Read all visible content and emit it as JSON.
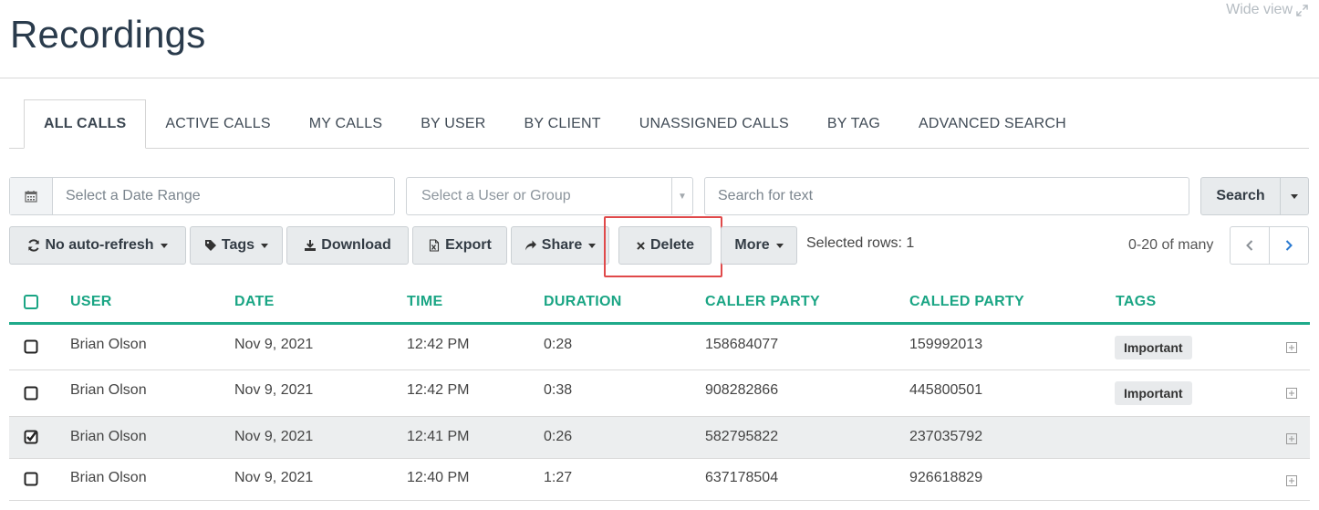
{
  "header": {
    "title": "Recordings",
    "wide_view": "Wide view"
  },
  "tabs": [
    {
      "label": "ALL CALLS",
      "active": true
    },
    {
      "label": "ACTIVE CALLS"
    },
    {
      "label": "MY CALLS"
    },
    {
      "label": "BY USER"
    },
    {
      "label": "BY CLIENT"
    },
    {
      "label": "UNASSIGNED CALLS"
    },
    {
      "label": "BY TAG"
    },
    {
      "label": "ADVANCED SEARCH"
    }
  ],
  "filters": {
    "date_placeholder": "Select a Date Range",
    "user_placeholder": "Select a User or Group",
    "text_placeholder": "Search for text",
    "search_label": "Search"
  },
  "toolbar": {
    "refresh_label": "No auto-refresh",
    "tags_label": "Tags",
    "download_label": "Download",
    "export_label": "Export",
    "share_label": "Share",
    "delete_label": "Delete",
    "more_label": "More",
    "selected_rows": "Selected rows: 1",
    "pager_info": "0-20 of many"
  },
  "table": {
    "headers": {
      "user": "USER",
      "date": "DATE",
      "time": "TIME",
      "duration": "DURATION",
      "caller": "CALLER PARTY",
      "called": "CALLED PARTY",
      "tags": "TAGS"
    },
    "rows": [
      {
        "user": "Brian Olson",
        "date": "Nov 9, 2021",
        "time": "12:42 PM",
        "duration": "0:28",
        "caller": "158684077",
        "called": "159992013",
        "tag": "Important",
        "checked": false
      },
      {
        "user": "Brian Olson",
        "date": "Nov 9, 2021",
        "time": "12:42 PM",
        "duration": "0:38",
        "caller": "908282866",
        "called": "445800501",
        "tag": "Important",
        "checked": false
      },
      {
        "user": "Brian Olson",
        "date": "Nov 9, 2021",
        "time": "12:41 PM",
        "duration": "0:26",
        "caller": "582795822",
        "called": "237035792",
        "tag": "",
        "checked": true
      },
      {
        "user": "Brian Olson",
        "date": "Nov 9, 2021",
        "time": "12:40 PM",
        "duration": "1:27",
        "caller": "637178504",
        "called": "926618829",
        "tag": "",
        "checked": false
      }
    ]
  },
  "colors": {
    "accent": "#1aa584",
    "highlight": "#e0494a",
    "title": "#2a3b4c"
  }
}
